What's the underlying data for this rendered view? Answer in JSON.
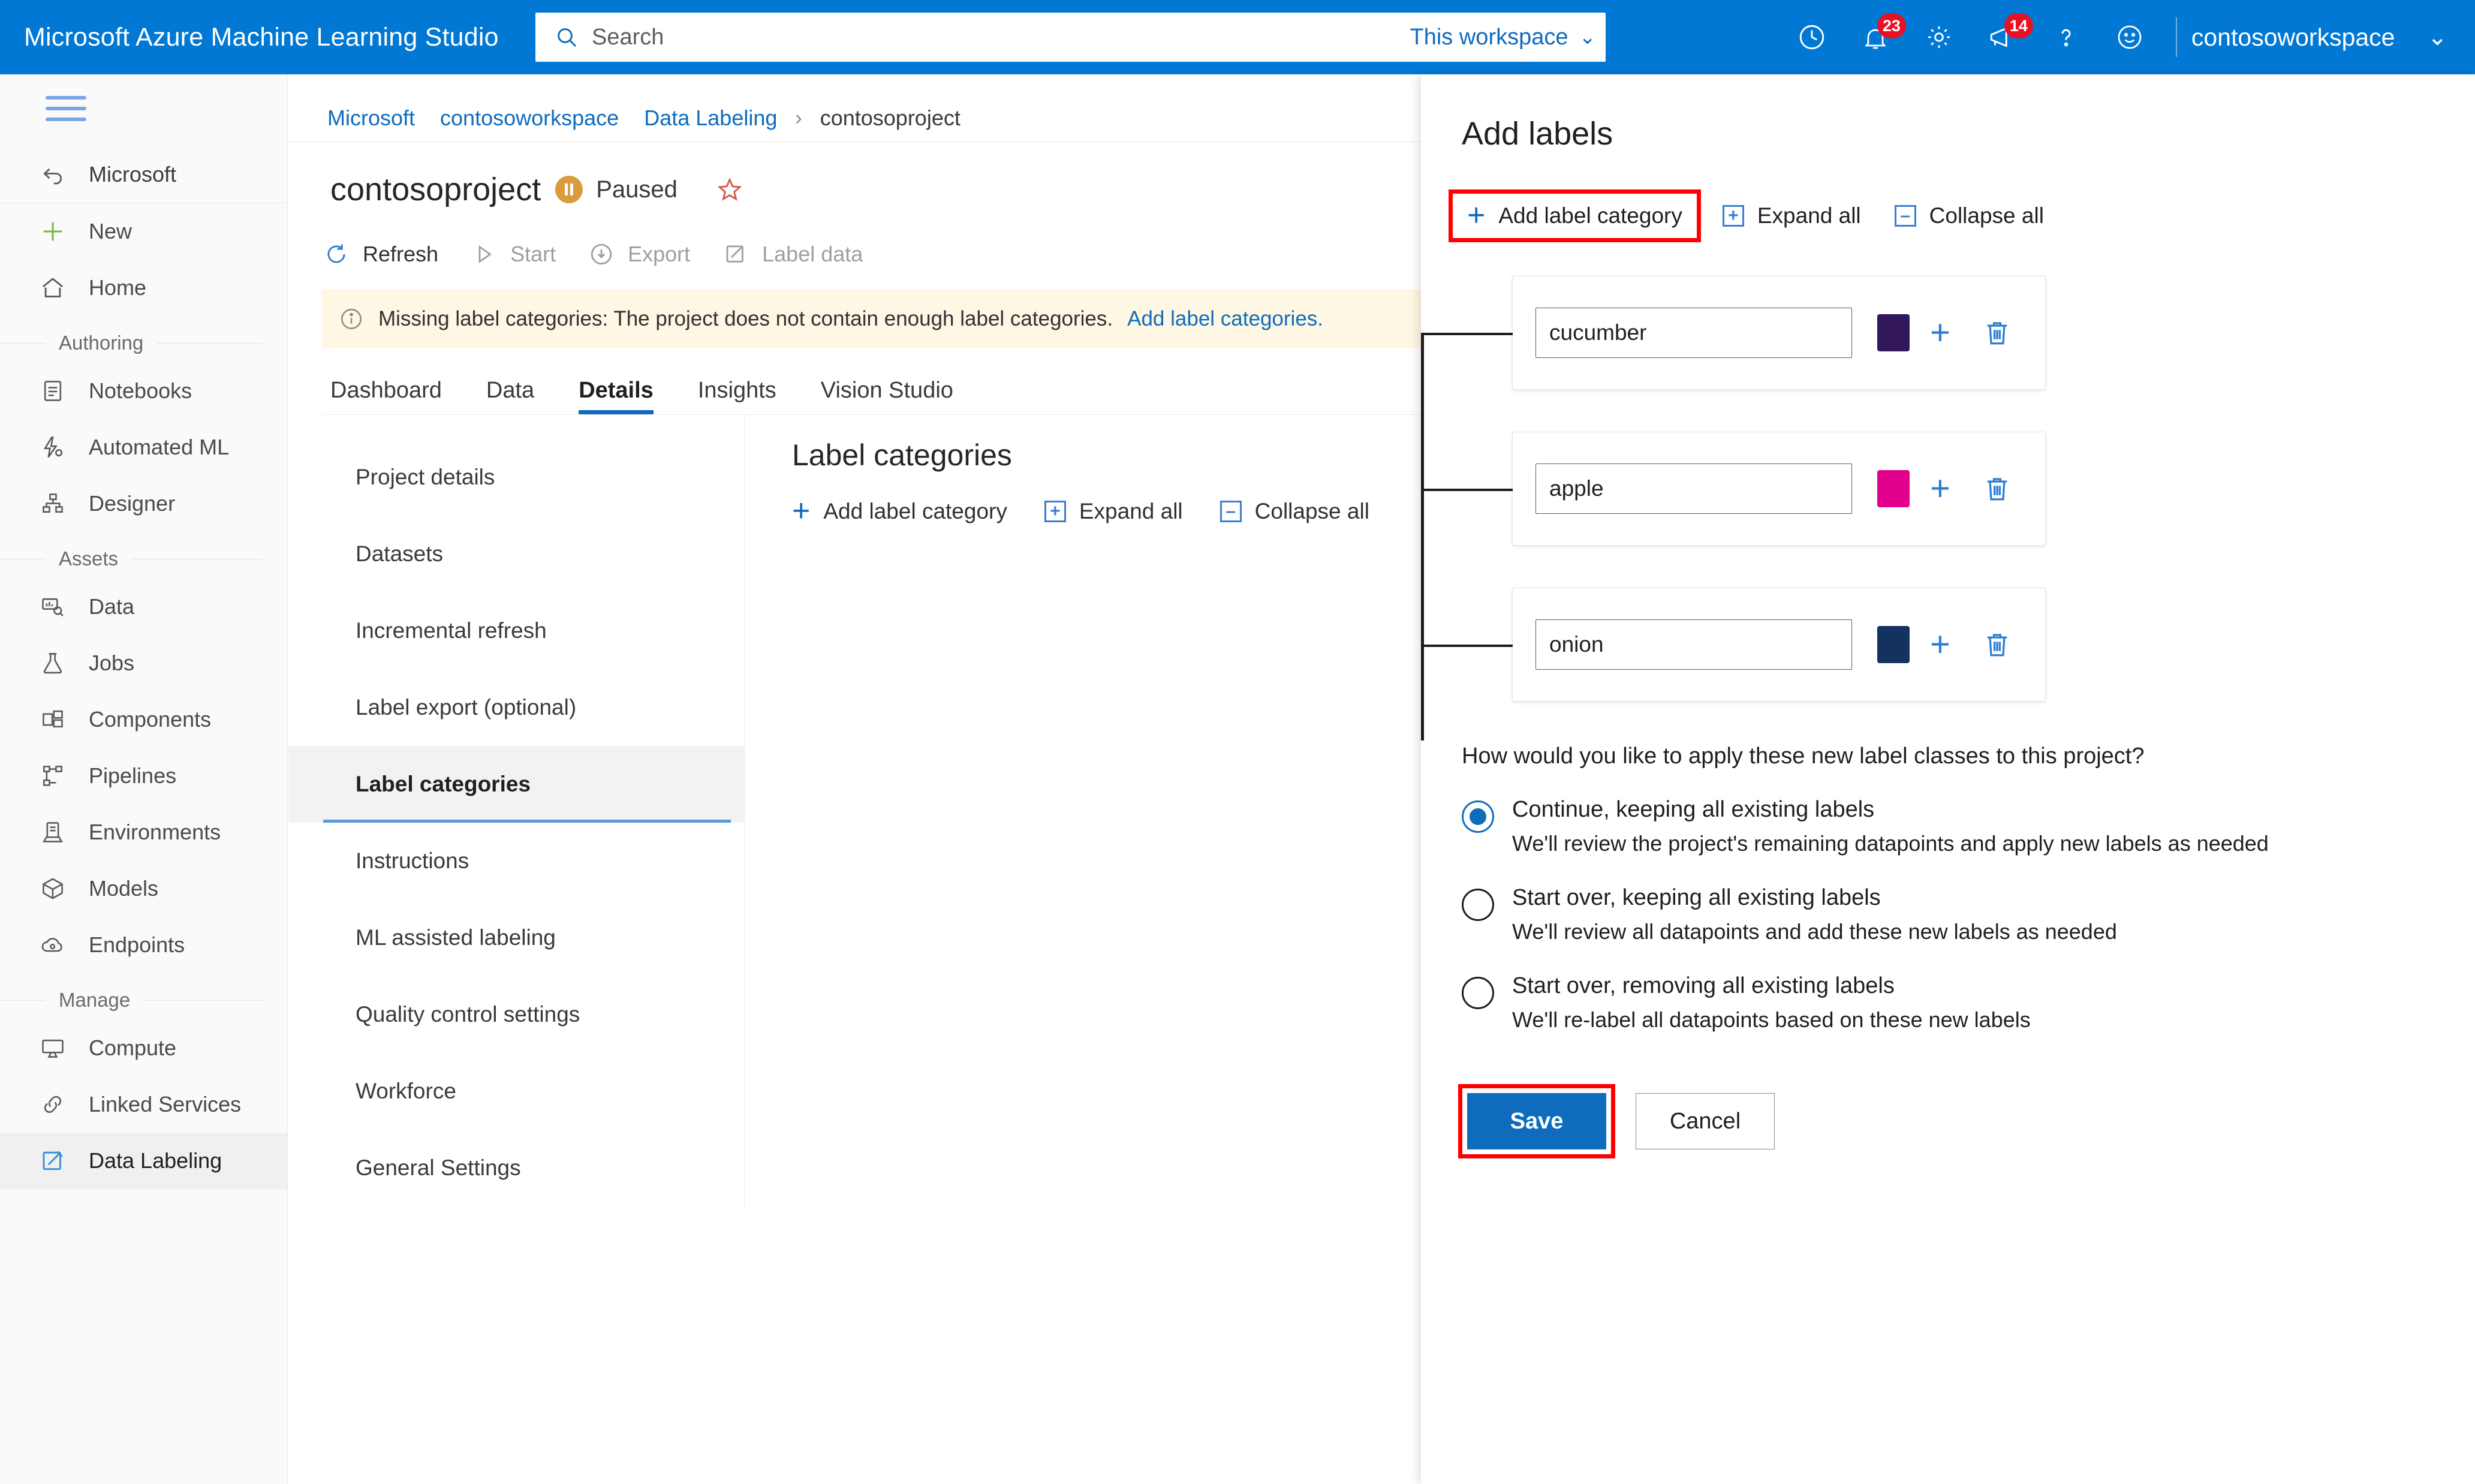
{
  "topbar": {
    "brand": "Microsoft Azure Machine Learning Studio",
    "search_placeholder": "Search",
    "search_value": "",
    "scope_label": "This workspace",
    "workspace": "contosoworkspace",
    "notifications_badge": "23",
    "announcements_badge": "14",
    "icons": [
      "history-icon",
      "bell-icon",
      "gear-icon",
      "megaphone-icon",
      "help-icon",
      "feedback-icon"
    ],
    "accent": "#0078d4"
  },
  "sidebar": {
    "back_label": "Microsoft",
    "items_top": [
      {
        "label": "New",
        "icon": "plus-icon"
      },
      {
        "label": "Home",
        "icon": "home-icon"
      }
    ],
    "groups": [
      {
        "title": "Authoring",
        "items": [
          {
            "label": "Notebooks",
            "icon": "notebook-icon"
          },
          {
            "label": "Automated ML",
            "icon": "automated-ml-icon"
          },
          {
            "label": "Designer",
            "icon": "designer-icon"
          }
        ]
      },
      {
        "title": "Assets",
        "items": [
          {
            "label": "Data",
            "icon": "data-icon"
          },
          {
            "label": "Jobs",
            "icon": "jobs-icon"
          },
          {
            "label": "Components",
            "icon": "components-icon"
          },
          {
            "label": "Pipelines",
            "icon": "pipelines-icon"
          },
          {
            "label": "Environments",
            "icon": "environments-icon"
          },
          {
            "label": "Models",
            "icon": "models-icon"
          },
          {
            "label": "Endpoints",
            "icon": "endpoints-icon"
          }
        ]
      },
      {
        "title": "Manage",
        "items": [
          {
            "label": "Compute",
            "icon": "compute-icon"
          },
          {
            "label": "Linked Services",
            "icon": "linked-services-icon"
          },
          {
            "label": "Data Labeling",
            "icon": "data-labeling-icon",
            "active": true
          }
        ]
      }
    ]
  },
  "breadcrumb": {
    "items": [
      "Microsoft",
      "contosoworkspace",
      "Data Labeling"
    ],
    "current": "contosoproject",
    "separator": "›"
  },
  "project": {
    "title": "contosoproject",
    "status": "Paused",
    "status_icon": "pause-icon",
    "favorite_icon": "star-icon"
  },
  "commandbar": [
    {
      "label": "Refresh",
      "icon": "refresh-icon",
      "disabled": false
    },
    {
      "label": "Start",
      "icon": "play-icon",
      "disabled": true
    },
    {
      "label": "Export",
      "icon": "export-icon",
      "disabled": true
    },
    {
      "label": "Label data",
      "icon": "label-data-icon",
      "disabled": true
    }
  ],
  "banner": {
    "icon": "info-icon",
    "text": "Missing label categories: The project does not contain enough label categories.",
    "link": "Add label categories."
  },
  "tabs": [
    {
      "label": "Dashboard",
      "active": false
    },
    {
      "label": "Data",
      "active": false
    },
    {
      "label": "Details",
      "active": true
    },
    {
      "label": "Insights",
      "active": false
    },
    {
      "label": "Vision Studio",
      "active": false
    }
  ],
  "details_nav": [
    {
      "label": "Project details",
      "active": false
    },
    {
      "label": "Datasets",
      "active": false
    },
    {
      "label": "Incremental refresh",
      "active": false
    },
    {
      "label": "Label export (optional)",
      "active": false
    },
    {
      "label": "Label categories",
      "active": true
    },
    {
      "label": "Instructions",
      "active": false
    },
    {
      "label": "ML assisted labeling",
      "active": false
    },
    {
      "label": "Quality control settings",
      "active": false
    },
    {
      "label": "Workforce",
      "active": false
    },
    {
      "label": "General Settings",
      "active": false
    }
  ],
  "label_categories_section": {
    "title": "Label categories",
    "actions": [
      {
        "label": "Add label category",
        "icon": "plus-icon"
      },
      {
        "label": "Expand all",
        "icon": "expand-all-icon"
      },
      {
        "label": "Collapse all",
        "icon": "collapse-all-icon"
      }
    ]
  },
  "panel": {
    "title": "Add labels",
    "toolbar": [
      {
        "label": "Add label category",
        "icon": "plus-icon",
        "highlighted": true
      },
      {
        "label": "Expand all",
        "icon": "expand-all-icon",
        "highlighted": false
      },
      {
        "label": "Collapse all",
        "icon": "collapse-all-icon",
        "highlighted": false
      }
    ],
    "categories": [
      {
        "name": "cucumber",
        "color": "#32175c",
        "add_icon": "plus-icon",
        "delete_icon": "trash-icon"
      },
      {
        "name": "apple",
        "color": "#e3008c",
        "add_icon": "plus-icon",
        "delete_icon": "trash-icon"
      },
      {
        "name": "onion",
        "color": "#14325f",
        "add_icon": "plus-icon",
        "delete_icon": "trash-icon"
      }
    ],
    "question": "How would you like to apply these new label classes to this project?",
    "options": [
      {
        "label": "Continue, keeping all existing labels",
        "description": "We'll review the project's remaining datapoints and apply new labels as needed",
        "selected": true
      },
      {
        "label": "Start over, keeping all existing labels",
        "description": "We'll review all datapoints and add these new labels as needed",
        "selected": false
      },
      {
        "label": "Start over, removing all existing labels",
        "description": "We'll re-label all datapoints based on these new labels",
        "selected": false
      }
    ],
    "save_label": "Save",
    "cancel_label": "Cancel",
    "highlight_color": "#ff0000",
    "primary_color": "#0f6cbd"
  }
}
